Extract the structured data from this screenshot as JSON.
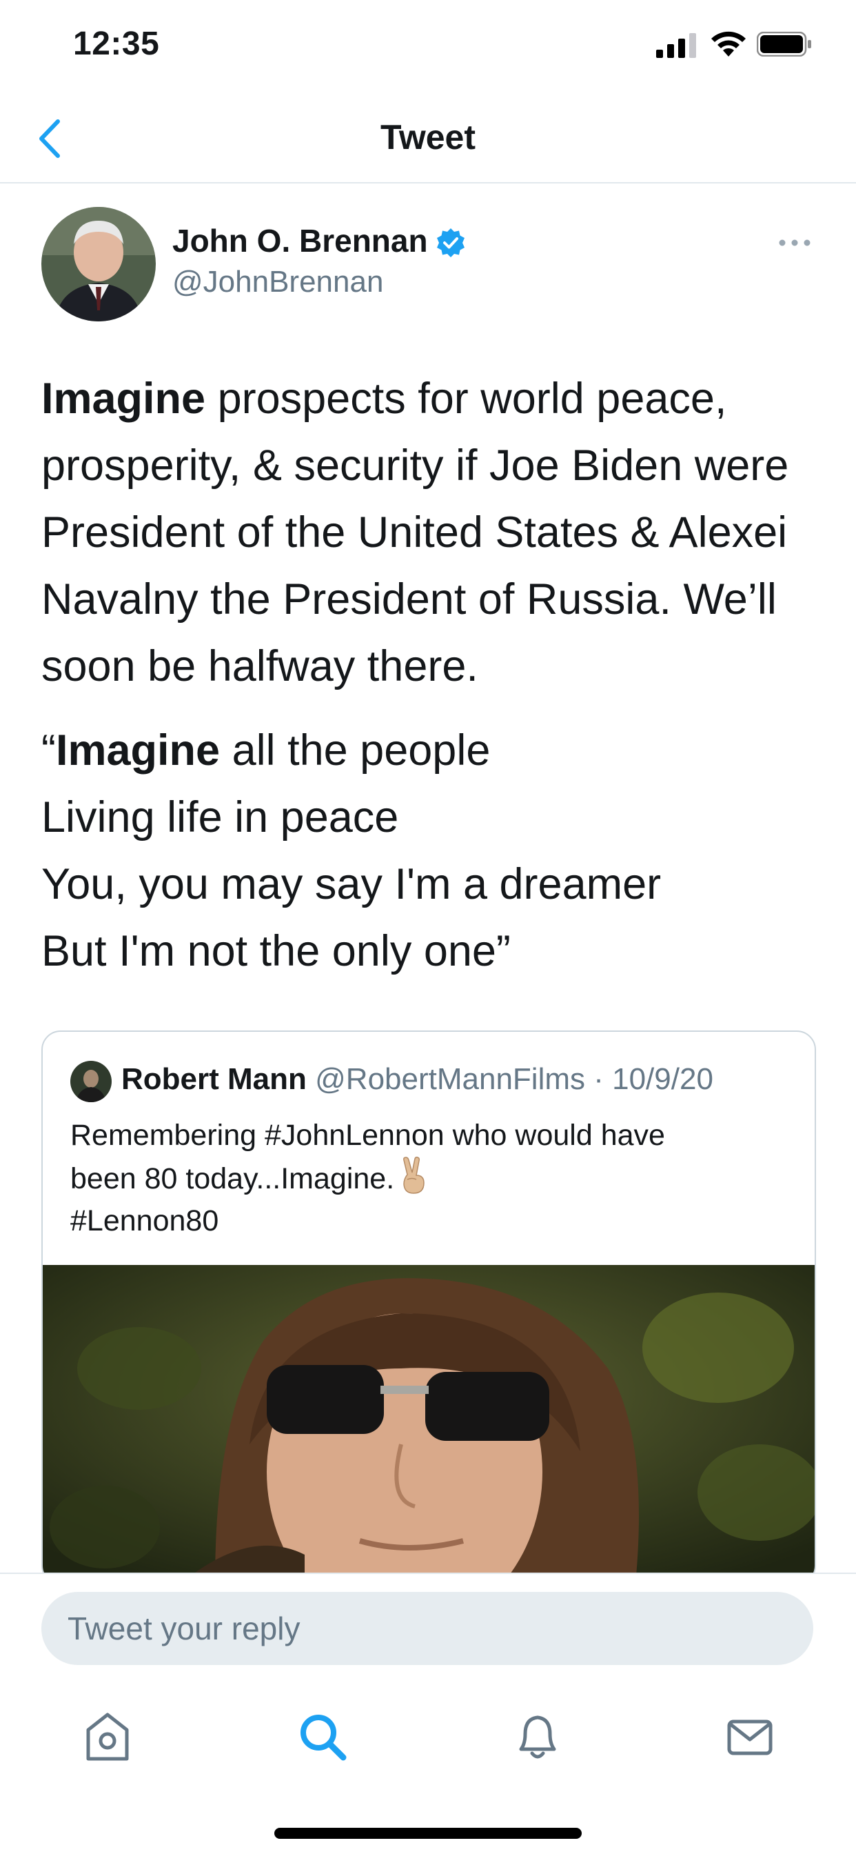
{
  "status_bar": {
    "time": "12:35"
  },
  "nav": {
    "title": "Tweet"
  },
  "tweet": {
    "author_name": "John O. Brennan",
    "handle": "@JohnBrennan",
    "body": {
      "p1_bold": "Imagine",
      "p1_text": " prospects for world peace, prosperity, & security if Joe Biden were President of the United States & Alexei Navalny the President of Russia. We’ll soon be halfway there.",
      "p2_open": "“",
      "p2_bold": "Imagine",
      "p2_line1": " all the people",
      "p2_line2": "Living life in peace",
      "p2_line3": "You, you may say I'm a dreamer",
      "p2_line4": "But I'm not the only one”"
    }
  },
  "quoted_tweet": {
    "author_name": "Robert Mann",
    "handle": "@RobertMannFilms",
    "separator": " · ",
    "date": "10/9/20",
    "text_line1": "Remembering #JohnLennon who would have",
    "text_line2": "been 80 today...Imagine.",
    "text_line3": "#Lennon80"
  },
  "reply": {
    "placeholder": "Tweet your reply"
  },
  "tab_bar": {
    "icons": [
      "home-icon",
      "search-icon",
      "notifications-icon",
      "messages-icon"
    ]
  },
  "colors": {
    "accent": "#1da1f2",
    "text": "#14171a",
    "secondary": "#657786",
    "border": "#ccd6dd"
  }
}
